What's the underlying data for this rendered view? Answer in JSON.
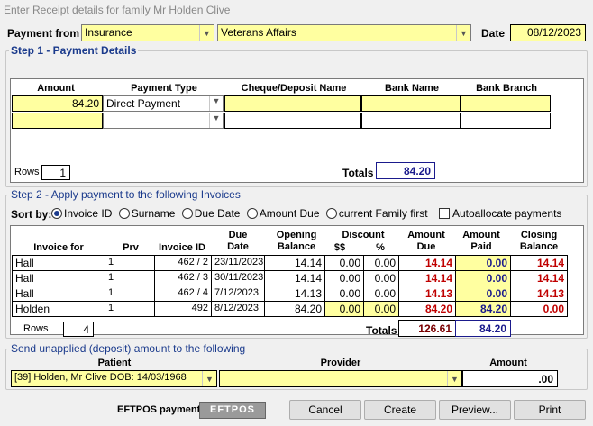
{
  "window_title": "Enter Receipt details for family Mr  Holden  Clive",
  "payment_from": {
    "label": "Payment from",
    "source": "Insurance",
    "payer": "Veterans Affairs",
    "date_label": "Date",
    "date": "08/12/2023"
  },
  "step1": {
    "title": "Step 1 - Payment Details",
    "headers": {
      "amount": "Amount",
      "type": "Payment Type",
      "cheque": "Cheque/Deposit Name",
      "bank": "Bank Name",
      "branch": "Bank Branch"
    },
    "rows": [
      {
        "amount": "84.20",
        "type": "Direct Payment",
        "cheque": "",
        "bank": "",
        "branch": ""
      },
      {
        "amount": "",
        "type": "",
        "cheque": "",
        "bank": "",
        "branch": ""
      }
    ],
    "rows_label": "Rows",
    "rows_count": "1",
    "totals_label": "Totals",
    "total": "84.20"
  },
  "step2": {
    "title": "Step 2 - Apply payment to the following Invoices",
    "sort_label": "Sort by:",
    "sort_options": [
      "Invoice ID",
      "Surname",
      "Due Date",
      "Amount Due",
      "current Family first"
    ],
    "autoallocate": "Autoallocate payments",
    "headers": {
      "invoice_for": "Invoice for",
      "prv": "Prv",
      "invoice_id": "Invoice ID",
      "due_date": "Due\nDate",
      "opening_balance": "Opening\nBalance",
      "discount": "Discount",
      "disc_dollars": "$$",
      "disc_pct": "%",
      "amount_due": "Amount\nDue",
      "amount_paid": "Amount\nPaid",
      "closing_balance": "Closing\nBalance"
    },
    "rows": [
      {
        "invoice_for": "Hall",
        "prv": "1",
        "invoice_id": "462 / 2",
        "due_date": "23/11/2023",
        "opening": "14.14",
        "disc": "0.00",
        "pct": "0.00",
        "due": "14.14",
        "paid": "0.00",
        "closing": "14.14"
      },
      {
        "invoice_for": "Hall",
        "prv": "1",
        "invoice_id": "462 / 3",
        "due_date": "30/11/2023",
        "opening": "14.14",
        "disc": "0.00",
        "pct": "0.00",
        "due": "14.14",
        "paid": "0.00",
        "closing": "14.14"
      },
      {
        "invoice_for": "Hall",
        "prv": "1",
        "invoice_id": "462 / 4",
        "due_date": "7/12/2023",
        "opening": "14.13",
        "disc": "0.00",
        "pct": "0.00",
        "due": "14.13",
        "paid": "0.00",
        "closing": "14.13"
      },
      {
        "invoice_for": "Holden",
        "prv": "1",
        "invoice_id": "492",
        "due_date": "8/12/2023",
        "opening": "84.20",
        "disc": "0.00",
        "pct": "0.00",
        "due": "84.20",
        "paid": "84.20",
        "closing": "0.00"
      }
    ],
    "rows_label": "Rows",
    "rows_count": "4",
    "totals_label": "Totals",
    "total_due": "126.61",
    "total_paid": "84.20"
  },
  "unapplied": {
    "title": "Send unapplied (deposit) amount to the following",
    "patient_label": "Patient",
    "provider_label": "Provider",
    "amount_label": "Amount",
    "patient": "[39] Holden, Mr Clive DOB: 14/03/1968",
    "provider": "",
    "amount": ".00"
  },
  "footer": {
    "eftpos_label": "EFTPOS payment",
    "eftpos_logo": "EFTPOS",
    "cancel": "Cancel",
    "create": "Create",
    "preview": "Preview...",
    "print": "Print"
  },
  "colors": {
    "group_title": "#1a3a8c",
    "due_red": "#c00000",
    "yellow": "#ffffa0"
  }
}
